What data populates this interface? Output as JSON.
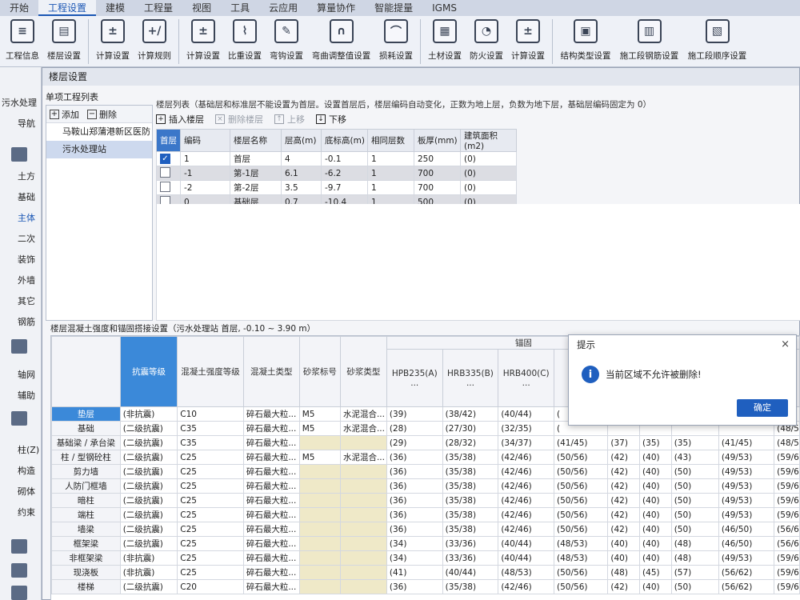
{
  "ribbon": {
    "tabs": [
      "开始",
      "工程设置",
      "建模",
      "工程量",
      "视图",
      "工具",
      "云应用",
      "算量协作",
      "智能提量",
      "IGMS"
    ],
    "active_index": 1
  },
  "toolbar": {
    "groups": [
      [
        {
          "label": "工程信息",
          "icon": "project-info-icon"
        },
        {
          "label": "楼层设置",
          "icon": "floor-settings-icon"
        }
      ],
      [
        {
          "label": "计算设置",
          "icon": "calc-settings-icon"
        },
        {
          "label": "计算规则",
          "icon": "calc-rules-icon"
        }
      ],
      [
        {
          "label": "计算设置",
          "icon": "calc-settings-icon"
        },
        {
          "label": "比重设置",
          "icon": "density-icon"
        },
        {
          "label": "弯钩设置",
          "icon": "hook-icon"
        },
        {
          "label": "弯曲调整值设置",
          "icon": "bend-adjust-icon"
        },
        {
          "label": "损耗设置",
          "icon": "loss-icon"
        }
      ],
      [
        {
          "label": "土材设置",
          "icon": "material-icon"
        },
        {
          "label": "防火设置",
          "icon": "fire-icon"
        },
        {
          "label": "计算设置",
          "icon": "calc-settings-icon"
        }
      ],
      [
        {
          "label": "结构类型设置",
          "icon": "structure-type-icon"
        },
        {
          "label": "施工段钢筋设置",
          "icon": "section-rebar-icon"
        },
        {
          "label": "施工段顺序设置",
          "icon": "section-order-icon"
        }
      ]
    ]
  },
  "left_sidebar": {
    "items": [
      "污水处理",
      "导航",
      "土方",
      "基础",
      "主体",
      "二次",
      "装饰",
      "外墙",
      "其它",
      "钢筋",
      "轴网",
      "辅助",
      "柱(Z)",
      "构造",
      "砌体",
      "约束"
    ]
  },
  "dialog": {
    "title": "楼层设置",
    "project_list": {
      "header": "单项工程列表",
      "add_label": "添加",
      "delete_label": "删除",
      "items": [
        "马鞍山郑蒲港新区医防",
        "污水处理站"
      ],
      "selected_index": 1
    },
    "floor_list": {
      "header": "楼层列表（基础层和标准层不能设置为首层。设置首层后，楼层编码自动变化，正数为地上层，负数为地下层，基础层编码固定为 0）",
      "insert_label": "插入楼层",
      "delete_label": "删除楼层",
      "up_label": "上移",
      "down_label": "下移",
      "columns": [
        "首层",
        "编码",
        "楼层名称",
        "层高(m)",
        "底标高(m)",
        "相同层数",
        "板厚(mm)",
        "建筑面积(m2)"
      ],
      "rows": [
        {
          "first": true,
          "code": "1",
          "name": "首层",
          "height": "4",
          "bottom": "-0.1",
          "same": "1",
          "slab": "250",
          "area": "(0)"
        },
        {
          "first": false,
          "code": "-1",
          "name": "第-1层",
          "height": "6.1",
          "bottom": "-6.2",
          "same": "1",
          "slab": "700",
          "area": "(0)"
        },
        {
          "first": false,
          "code": "-2",
          "name": "第-2层",
          "height": "3.5",
          "bottom": "-9.7",
          "same": "1",
          "slab": "700",
          "area": "(0)"
        },
        {
          "first": false,
          "code": "0",
          "name": "基础层",
          "height": "0.7",
          "bottom": "-10.4",
          "same": "1",
          "slab": "500",
          "area": "(0)"
        }
      ]
    },
    "strength": {
      "header": "楼层混凝土强度和锚固搭接设置（污水处理站 首层, -0.10 ~ 3.90 m）",
      "anchor_group": "锚固",
      "columns": [
        "抗震等级",
        "混凝土强度等级",
        "混凝土类型",
        "砂浆标号",
        "砂浆类型",
        "HPB235(A)\n...",
        "HRB335(B)\n...",
        "HRB400(C)\n..."
      ],
      "rows": [
        {
          "name": "垫层",
          "seis": "(非抗震)",
          "grade": "C10",
          "type": "碎石最大粒...",
          "mortar": "M5",
          "mtype": "水泥混合...",
          "a": "(39)",
          "b": "(38/42)",
          "c": "(40/44)",
          "d": "(",
          "e": "",
          "f": "",
          "g": "",
          "h": "",
          "i": ""
        },
        {
          "name": "基础",
          "seis": "(二级抗震)",
          "grade": "C35",
          "type": "碎石最大粒...",
          "mortar": "M5",
          "mtype": "水泥混合...",
          "a": "(28)",
          "b": "(27/30)",
          "c": "(32/35)",
          "d": "(",
          "e": "",
          "f": "",
          "g": "",
          "h": "",
          "i": "(48/5"
        },
        {
          "name": "基础梁 / 承台梁",
          "seis": "(二级抗震)",
          "grade": "C35",
          "type": "碎石最大粒...",
          "mortar": "",
          "mtype": "",
          "a": "(29)",
          "b": "(28/32)",
          "c": "(34/37)",
          "d": "(41/45)",
          "e": "(37)",
          "f": "(35)",
          "g": "(35)",
          "h": "(41/45)",
          "i": "(48/5"
        },
        {
          "name": "柱 / 型钢砼柱",
          "seis": "(二级抗震)",
          "grade": "C25",
          "type": "碎石最大粒...",
          "mortar": "M5",
          "mtype": "水泥混合...",
          "a": "(36)",
          "b": "(35/38)",
          "c": "(42/46)",
          "d": "(50/56)",
          "e": "(42)",
          "f": "(40)",
          "g": "(43)",
          "h": "(49/53)",
          "i": "(59/6"
        },
        {
          "name": "剪力墙",
          "seis": "(二级抗震)",
          "grade": "C25",
          "type": "碎石最大粒...",
          "mortar": "",
          "mtype": "",
          "a": "(36)",
          "b": "(35/38)",
          "c": "(42/46)",
          "d": "(50/56)",
          "e": "(42)",
          "f": "(40)",
          "g": "(50)",
          "h": "(49/53)",
          "i": "(59/6"
        },
        {
          "name": "人防门框墙",
          "seis": "(二级抗震)",
          "grade": "C25",
          "type": "碎石最大粒...",
          "mortar": "",
          "mtype": "",
          "a": "(36)",
          "b": "(35/38)",
          "c": "(42/46)",
          "d": "(50/56)",
          "e": "(42)",
          "f": "(40)",
          "g": "(50)",
          "h": "(49/53)",
          "i": "(59/6"
        },
        {
          "name": "暗柱",
          "seis": "(二级抗震)",
          "grade": "C25",
          "type": "碎石最大粒...",
          "mortar": "",
          "mtype": "",
          "a": "(36)",
          "b": "(35/38)",
          "c": "(42/46)",
          "d": "(50/56)",
          "e": "(42)",
          "f": "(40)",
          "g": "(50)",
          "h": "(49/53)",
          "i": "(59/6"
        },
        {
          "name": "端柱",
          "seis": "(二级抗震)",
          "grade": "C25",
          "type": "碎石最大粒...",
          "mortar": "",
          "mtype": "",
          "a": "(36)",
          "b": "(35/38)",
          "c": "(42/46)",
          "d": "(50/56)",
          "e": "(42)",
          "f": "(40)",
          "g": "(50)",
          "h": "(49/53)",
          "i": "(59/6"
        },
        {
          "name": "墙梁",
          "seis": "(二级抗震)",
          "grade": "C25",
          "type": "碎石最大粒...",
          "mortar": "",
          "mtype": "",
          "a": "(36)",
          "b": "(35/38)",
          "c": "(42/46)",
          "d": "(50/56)",
          "e": "(42)",
          "f": "(40)",
          "g": "(50)",
          "h": "(46/50)",
          "i": "(56/6"
        },
        {
          "name": "框架梁",
          "seis": "(二级抗震)",
          "grade": "C25",
          "type": "碎石最大粒...",
          "mortar": "",
          "mtype": "",
          "a": "(34)",
          "b": "(33/36)",
          "c": "(40/44)",
          "d": "(48/53)",
          "e": "(40)",
          "f": "(40)",
          "g": "(48)",
          "h": "(46/50)",
          "i": "(56/6"
        },
        {
          "name": "非框架梁",
          "seis": "(非抗震)",
          "grade": "C25",
          "type": "碎石最大粒...",
          "mortar": "",
          "mtype": "",
          "a": "(34)",
          "b": "(33/36)",
          "c": "(40/44)",
          "d": "(48/53)",
          "e": "(40)",
          "f": "(40)",
          "g": "(48)",
          "h": "(49/53)",
          "i": "(59/6"
        },
        {
          "name": "现浇板",
          "seis": "(非抗震)",
          "grade": "C25",
          "type": "碎石最大粒...",
          "mortar": "",
          "mtype": "",
          "a": "(41)",
          "b": "(40/44)",
          "c": "(48/53)",
          "d": "(50/56)",
          "e": "(48)",
          "f": "(45)",
          "g": "(57)",
          "h": "(56/62)",
          "i": "(59/6"
        },
        {
          "name": "楼梯",
          "seis": "(二级抗震)",
          "grade": "C20",
          "type": "碎石最大粒...",
          "mortar": "",
          "mtype": "",
          "a": "(36)",
          "b": "(35/38)",
          "c": "(42/46)",
          "d": "(50/56)",
          "e": "(42)",
          "f": "(40)",
          "g": "(50)",
          "h": "(56/62)",
          "i": "(59/6"
        }
      ]
    }
  },
  "prompt": {
    "title": "提示",
    "message": "当前区域不允许被删除!",
    "ok_label": "确定",
    "close_glyph": "×",
    "info_glyph": "i"
  },
  "colors": {
    "accent": "#1f5fbf",
    "header_blue": "#3b89d9"
  }
}
